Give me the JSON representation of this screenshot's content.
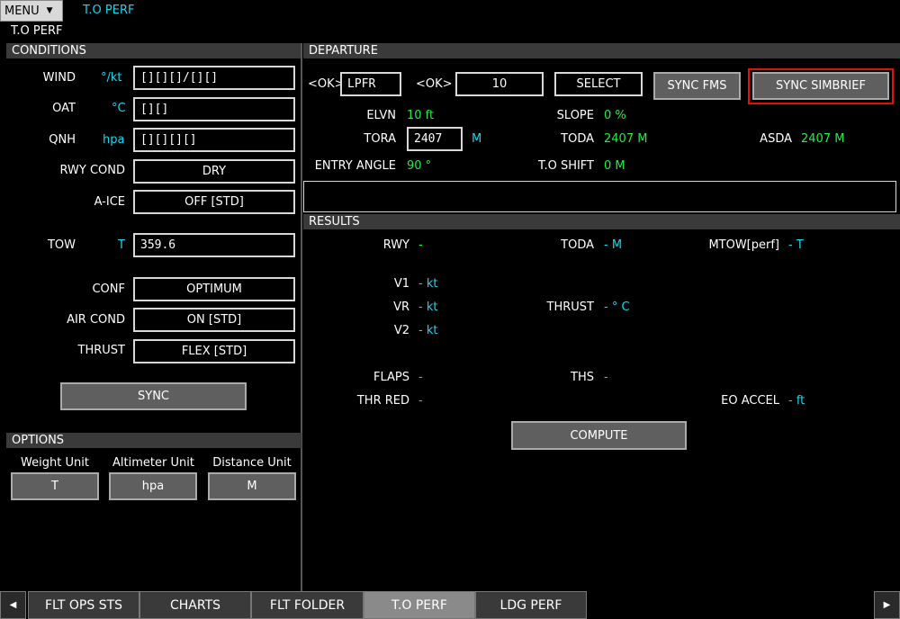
{
  "header": {
    "menu_label": "MENU",
    "page_title": "T.O PERF",
    "sub_title": "T.O PERF"
  },
  "conditions": {
    "title": "CONDITIONS",
    "wind": {
      "label": "WIND",
      "unit": "°/kt",
      "value": "[][][]/[][]"
    },
    "oat": {
      "label": "OAT",
      "unit": "°C",
      "value": "[][]"
    },
    "qnh": {
      "label": "QNH",
      "unit": "hpa",
      "value": "[][][][]"
    },
    "rwy_cond": {
      "label": "RWY COND",
      "value": "DRY"
    },
    "a_ice": {
      "label": "A-ICE",
      "value": "OFF [STD]"
    },
    "tow": {
      "label": "TOW",
      "unit": "T",
      "value": "359.6"
    },
    "conf": {
      "label": "CONF",
      "value": "OPTIMUM"
    },
    "air_cond": {
      "label": "AIR COND",
      "value": "ON [STD]"
    },
    "thrust": {
      "label": "THRUST",
      "value": "FLEX [STD]"
    },
    "sync_label": "SYNC"
  },
  "options": {
    "title": "OPTIONS",
    "weight_unit": {
      "label": "Weight Unit",
      "value": "T"
    },
    "altimeter_unit": {
      "label": "Altimeter Unit",
      "value": "hpa"
    },
    "distance_unit": {
      "label": "Distance Unit",
      "value": "M"
    }
  },
  "departure": {
    "title": "DEPARTURE",
    "ok_label_1": "<OK>",
    "airport": "LPFR",
    "ok_label_2": "<OK>",
    "runway": "10",
    "select_label": "SELECT",
    "sync_fms_label": "SYNC FMS",
    "sync_simbrief_label": "SYNC SIMBRIEF",
    "elvn": {
      "label": "ELVN",
      "value": "10 ft"
    },
    "slope": {
      "label": "SLOPE",
      "value": "0 %"
    },
    "tora": {
      "label": "TORA",
      "value": "2407",
      "unit": "M"
    },
    "toda": {
      "label": "TODA",
      "value": "2407 M"
    },
    "asda": {
      "label": "ASDA",
      "value": "2407 M"
    },
    "entry_angle": {
      "label": "ENTRY ANGLE",
      "value": "90 °"
    },
    "to_shift": {
      "label": "T.O SHIFT",
      "value": "0 M"
    },
    "message": ""
  },
  "results": {
    "title": "RESULTS",
    "rwy": {
      "label": "RWY",
      "value": "-"
    },
    "toda": {
      "label": "TODA",
      "value": "- M"
    },
    "mtow": {
      "label": "MTOW[perf]",
      "value": "- T"
    },
    "v1": {
      "label": "V1",
      "value": "- kt"
    },
    "vr": {
      "label": "VR",
      "value": "- kt"
    },
    "thrust": {
      "label": "THRUST",
      "value": "- ° C"
    },
    "v2": {
      "label": "V2",
      "value": "- kt"
    },
    "flaps": {
      "label": "FLAPS",
      "value": "-"
    },
    "ths": {
      "label": "THS",
      "value": "-"
    },
    "thr_red": {
      "label": "THR RED",
      "value": "-"
    },
    "eo_accel": {
      "label": "EO ACCEL",
      "value": "- ft"
    },
    "compute_label": "COMPUTE"
  },
  "tabs": [
    {
      "label": "FLT OPS STS"
    },
    {
      "label": "CHARTS"
    },
    {
      "label": "FLT FOLDER"
    },
    {
      "label": "T.O PERF"
    },
    {
      "label": "LDG PERF"
    }
  ],
  "nav": {
    "prev_icon": "left-arrow-icon",
    "next_icon": "right-arrow-icon"
  },
  "colors": {
    "value_cyan": "#19d6f0",
    "value_green": "#22ee44",
    "highlight_red": "#e01010"
  }
}
